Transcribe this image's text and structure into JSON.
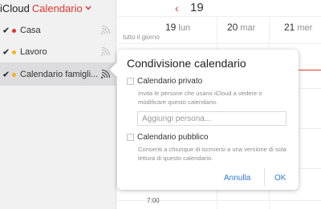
{
  "app": {
    "brand": "iCloud",
    "title": "Calendario"
  },
  "sidebar": {
    "items": [
      {
        "label": "Casa",
        "color": "#e0352b",
        "checked": true,
        "selected": false
      },
      {
        "label": "Lavoro",
        "color": "#f6b313",
        "checked": true,
        "selected": false
      },
      {
        "label": "Calendario famigli...",
        "color": "#f6b313",
        "checked": true,
        "selected": true
      }
    ]
  },
  "toolbar": {
    "prev_glyph": "‹",
    "month_number": "19"
  },
  "week": {
    "days": [
      {
        "num": "19",
        "name": "lun"
      },
      {
        "num": "20",
        "name": "mar"
      },
      {
        "num": "21",
        "name": "mer"
      }
    ],
    "all_day_label": "tutto il giorno",
    "time_label": "7:00"
  },
  "popover": {
    "title": "Condivisione calendario",
    "private_label": "Calendario privato",
    "private_desc": "Invita le persone che usano iCloud a vedere o modificare questo calendario.",
    "add_placeholder": "Aggiungi persona...",
    "public_label": "Calendario pubblico",
    "public_desc": "Consenti a chiunque di iscriversi a una versione di sola lettura di questo calendario.",
    "cancel_label": "Annulla",
    "ok_label": "OK"
  },
  "colors": {
    "accent_red": "#e0352b",
    "link_blue": "#2e7bd6"
  }
}
